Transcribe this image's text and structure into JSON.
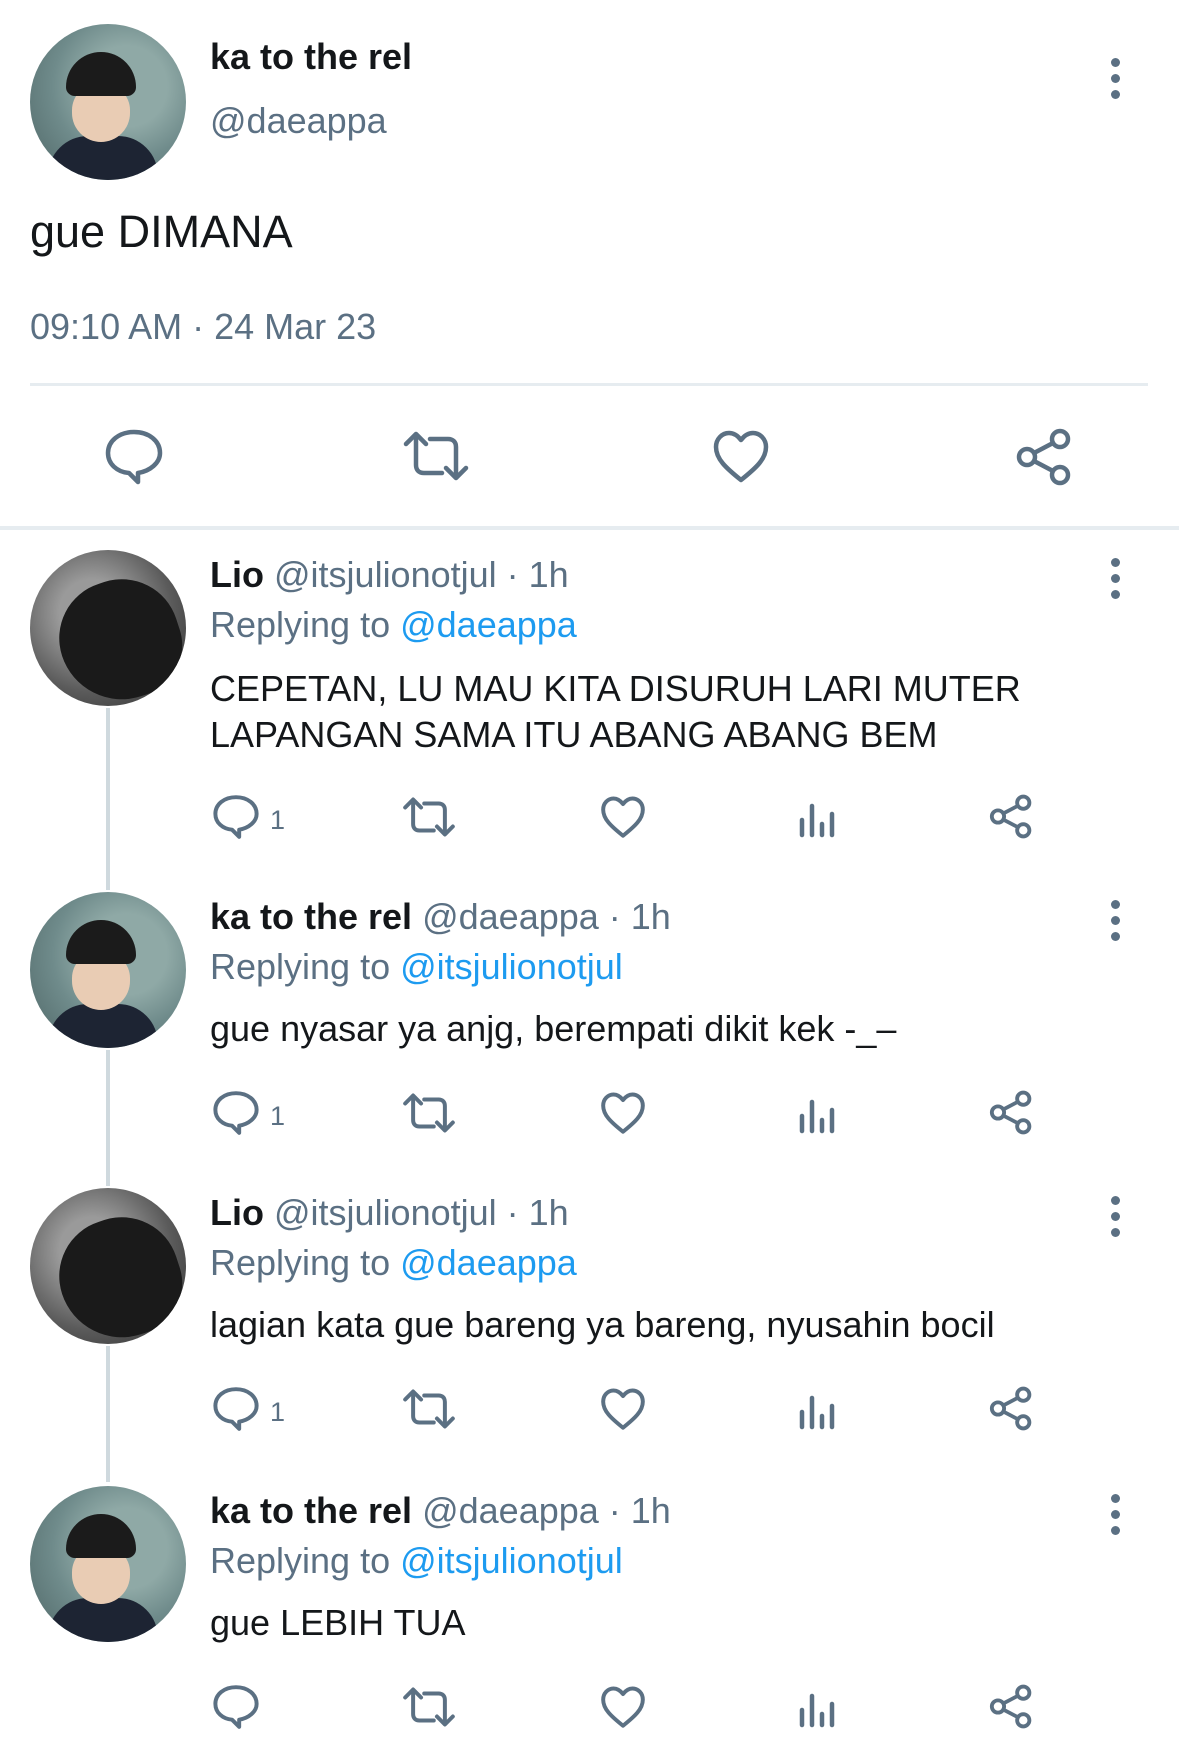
{
  "main_tweet": {
    "display_name": "ka to the rel",
    "handle": "@daeappa",
    "text": "gue DIMANA",
    "time": "09:10 AM",
    "separator": " · ",
    "date": "24 Mar 23",
    "actions": [
      "reply-icon",
      "retweet-icon",
      "like-icon",
      "share-icon"
    ]
  },
  "replies": [
    {
      "display_name": "Lio",
      "handle_time": "@itsjulionotjul · 1h",
      "replying_prefix": "Replying to ",
      "replying_to": "@daeappa",
      "text_line1": "CEPETAN, LU MAU KITA DISURUH LARI MUTER",
      "text_line2": "LAPANGAN SAMA ITU ABANG ABANG BEM",
      "reply_count": "1"
    },
    {
      "display_name": "ka to the rel",
      "handle_time": "@daeappa · 1h",
      "replying_prefix": "Replying to ",
      "replying_to": "@itsjulionotjul",
      "text_line1": "gue nyasar ya anjg, berempati dikit kek -_–",
      "reply_count": "1"
    },
    {
      "display_name": "Lio",
      "handle_time": "@itsjulionotjul · 1h",
      "replying_prefix": "Replying to ",
      "replying_to": "@daeappa",
      "text_line1": "lagian kata gue bareng ya bareng, nyusahin bocil",
      "reply_count": "1"
    },
    {
      "display_name": "ka to the rel",
      "handle_time": "@daeappa · 1h",
      "replying_prefix": "Replying to ",
      "replying_to": "@itsjulionotjul",
      "text_line1": "gue LEBIH TUA",
      "reply_count": ""
    }
  ],
  "colors": {
    "link": "#1d9bf0",
    "muted": "#5b7083",
    "text": "#14171a",
    "divider": "#e6ecf0"
  }
}
